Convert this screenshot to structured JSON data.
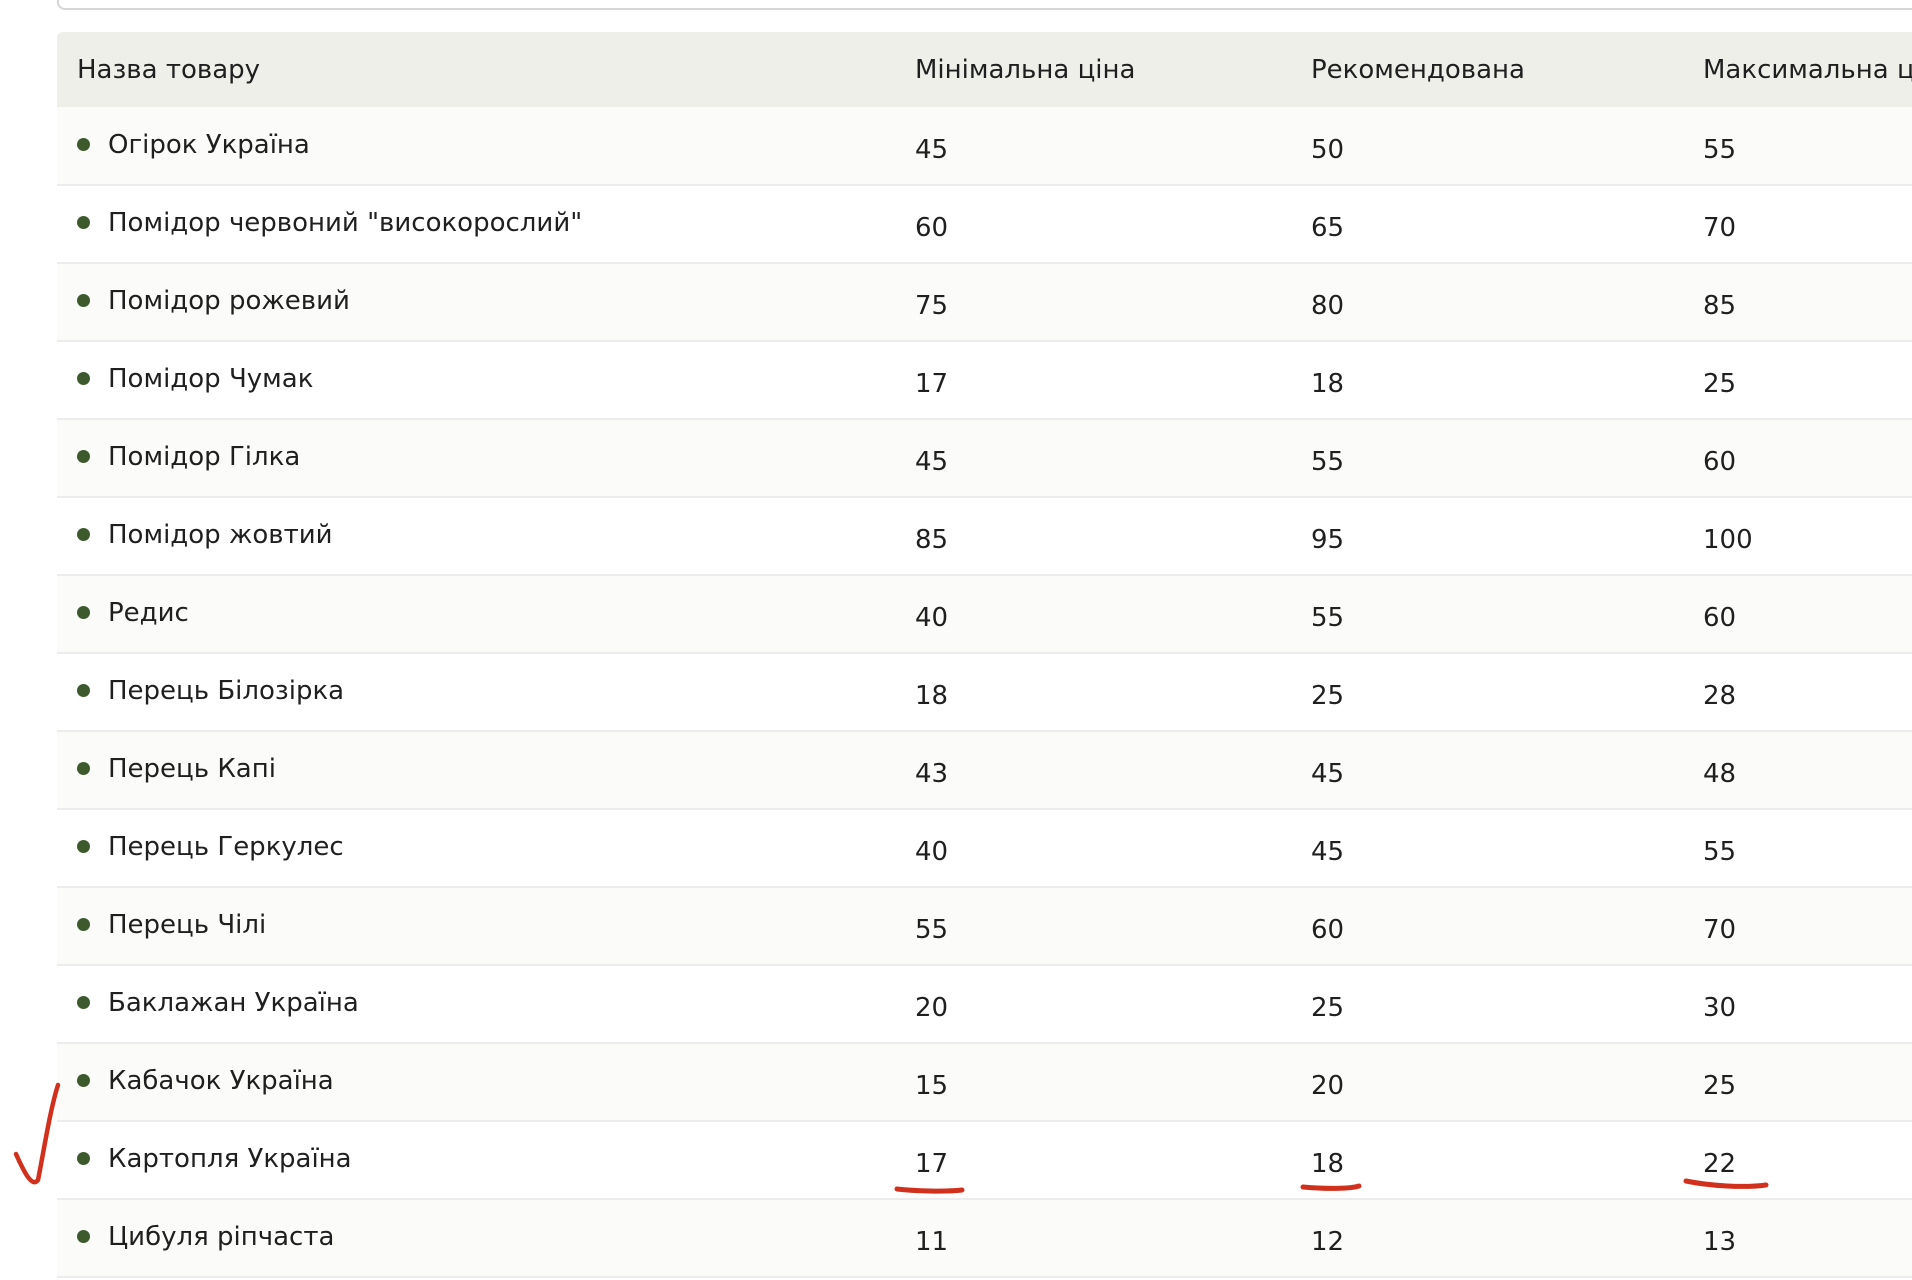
{
  "table": {
    "headers": [
      "Назва товару",
      "Мінімальна ціна",
      "Рекомендована",
      "Максимальна ціна"
    ],
    "rows": [
      {
        "name": "Огірок Україна",
        "min": "45",
        "rec": "50",
        "max": "55"
      },
      {
        "name": "Помідор червоний \"високорослий\"",
        "min": "60",
        "rec": "65",
        "max": "70"
      },
      {
        "name": "Помідор рожевий",
        "min": "75",
        "rec": "80",
        "max": "85"
      },
      {
        "name": "Помідор Чумак",
        "min": "17",
        "rec": "18",
        "max": "25"
      },
      {
        "name": "Помідор Гілка",
        "min": "45",
        "rec": "55",
        "max": "60"
      },
      {
        "name": "Помідор жовтий",
        "min": "85",
        "rec": "95",
        "max": "100"
      },
      {
        "name": "Редис",
        "min": "40",
        "rec": "55",
        "max": "60"
      },
      {
        "name": "Перець Білозірка",
        "min": "18",
        "rec": "25",
        "max": "28"
      },
      {
        "name": "Перець Капі",
        "min": "43",
        "rec": "45",
        "max": "48"
      },
      {
        "name": "Перець Геркулес",
        "min": "40",
        "rec": "45",
        "max": "55"
      },
      {
        "name": "Перець Чілі",
        "min": "55",
        "rec": "60",
        "max": "70"
      },
      {
        "name": "Баклажан Україна",
        "min": "20",
        "rec": "25",
        "max": "30"
      },
      {
        "name": "Кабачок Україна",
        "min": "15",
        "rec": "20",
        "max": "25"
      },
      {
        "name": "Картопля Україна",
        "min": "17",
        "rec": "18",
        "max": "22"
      },
      {
        "name": "Цибуля ріпчаста",
        "min": "11",
        "rec": "12",
        "max": "13"
      }
    ]
  },
  "annotations": {
    "checkmark_row": "Картопля Україна",
    "underlined_values": [
      "17",
      "18",
      "22"
    ],
    "annotation_color": "#d0301c"
  },
  "colors": {
    "header_bg": "#efefea",
    "bullet": "#3d5a2d"
  }
}
